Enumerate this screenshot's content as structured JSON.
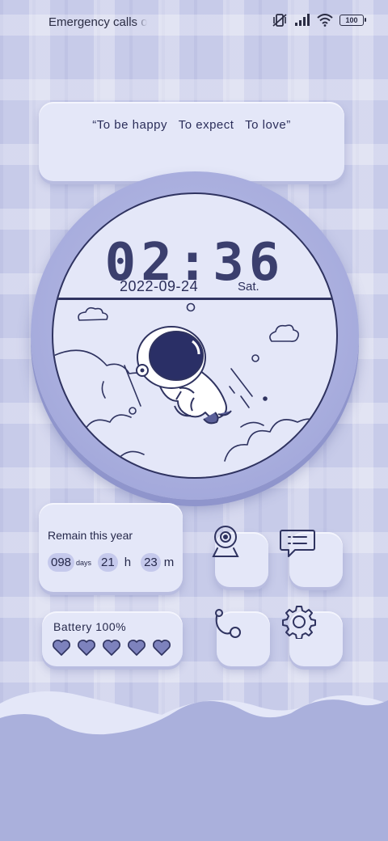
{
  "status_bar": {
    "carrier_text": "Emergency calls only",
    "battery_level": "100",
    "icons": [
      "vibrate-mute-icon",
      "signal-icon",
      "wifi-icon",
      "battery-icon"
    ]
  },
  "quote": {
    "text": "“To be happy   To expect   To love”"
  },
  "clock": {
    "time": "02:36",
    "date": "2022-09-24",
    "weekday": "Sat."
  },
  "remain_widget": {
    "title": "Remain this year",
    "days": "098",
    "days_unit": "days",
    "hours": "21",
    "hours_unit": "h",
    "minutes": "23",
    "minutes_unit": "m"
  },
  "battery_widget": {
    "label": "Battery 100%",
    "hearts_filled": 5,
    "hearts_total": 5
  },
  "app_icons": [
    "camera-icon",
    "message-icon",
    "phone-icon",
    "settings-icon"
  ],
  "colors": {
    "background": "#c7cbe9",
    "card": "#e4e7f8",
    "ring": "#a9aede",
    "ink": "#2f3360",
    "hill_dark": "#aab0dc",
    "hill_light": "#e4e7f8"
  }
}
